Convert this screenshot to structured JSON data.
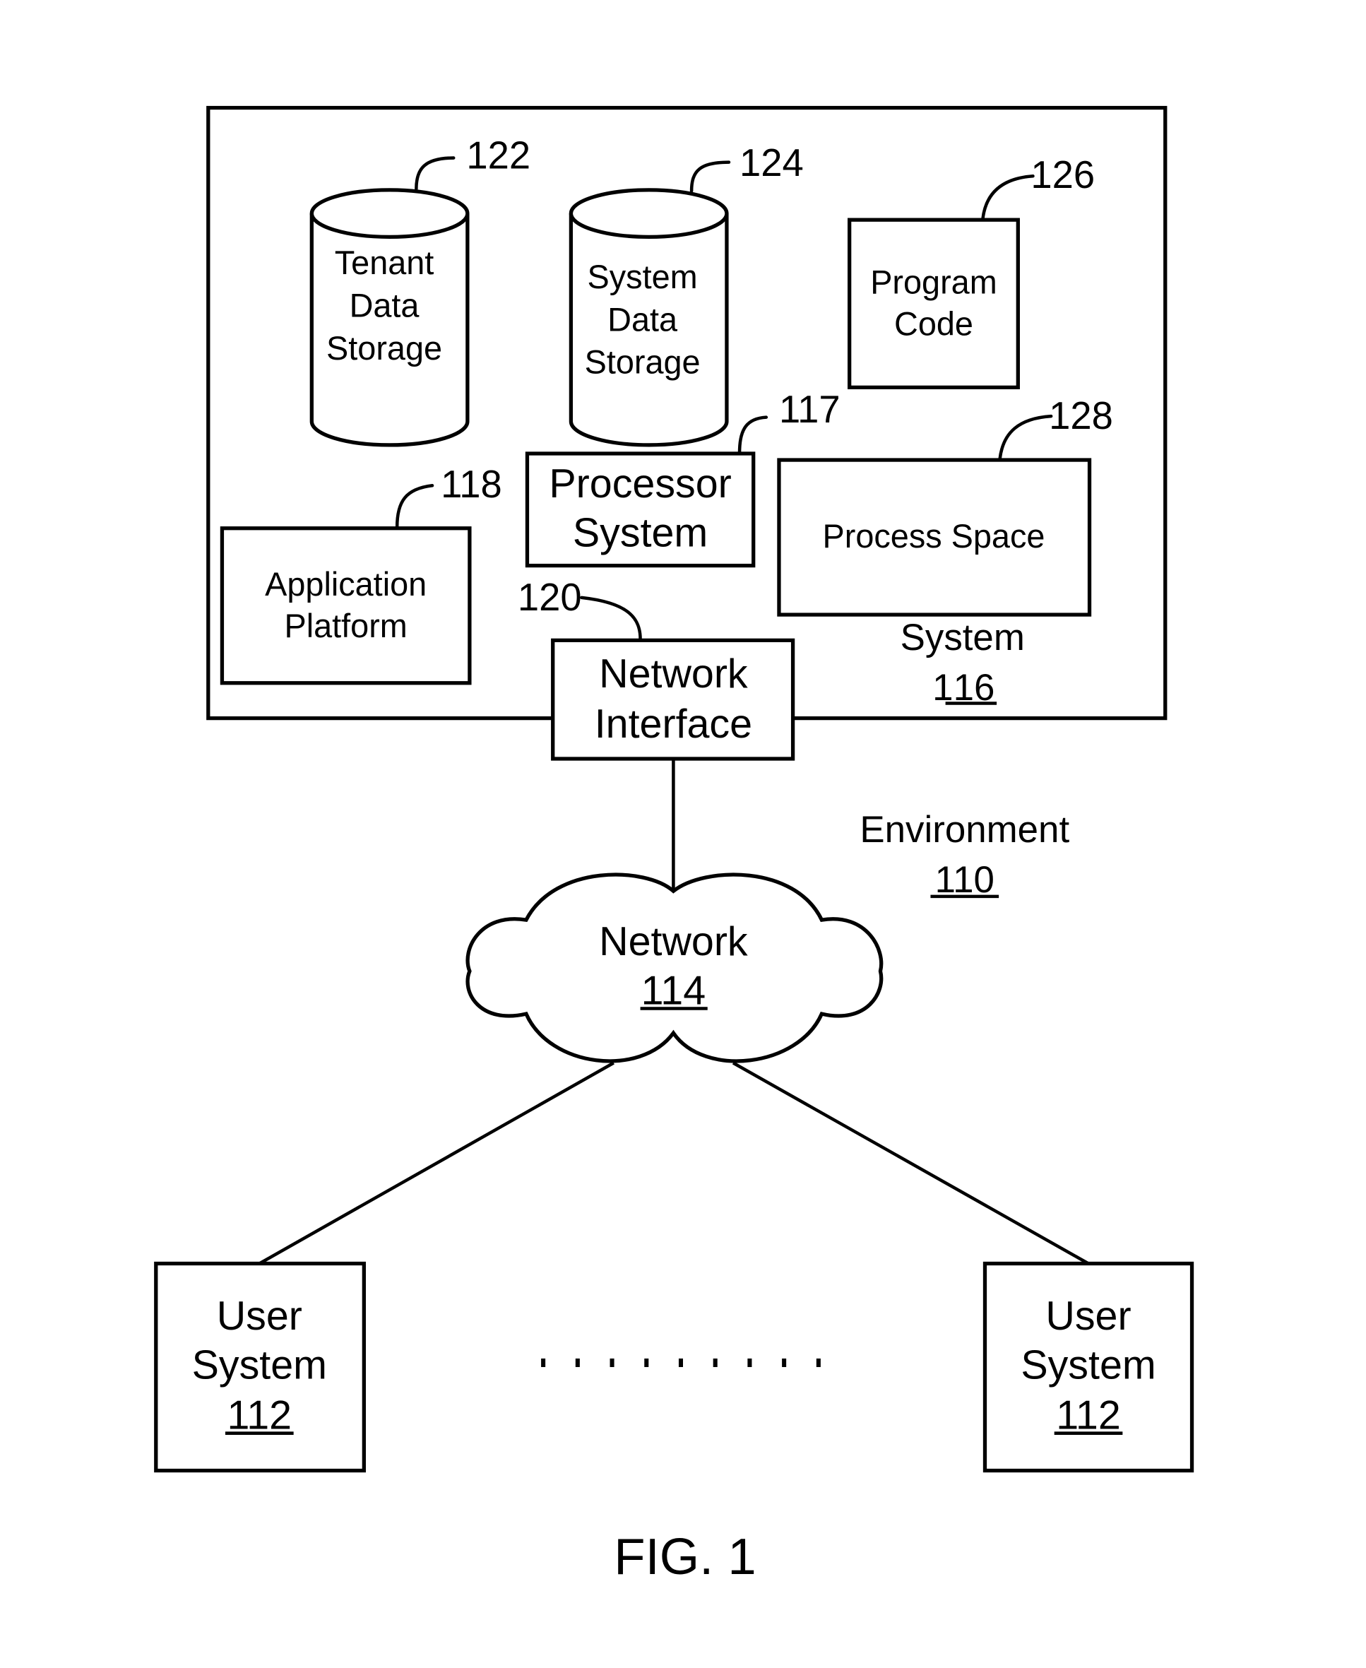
{
  "figure": {
    "caption": "FIG. 1",
    "colors": {
      "stroke": "#000000",
      "background": "#ffffff"
    }
  },
  "system": {
    "name": "System",
    "ref_prefix": "1",
    "ref_underlined": "16",
    "components": {
      "tenant_data_storage": {
        "lines": [
          "Tenant",
          "Data",
          "Storage"
        ],
        "ref": "122",
        "shape": "cylinder"
      },
      "system_data_storage": {
        "lines": [
          "System",
          "Data",
          "Storage"
        ],
        "ref": "124",
        "shape": "cylinder"
      },
      "program_code": {
        "lines": [
          "Program",
          "Code"
        ],
        "ref": "126",
        "shape": "box"
      },
      "processor_system": {
        "lines": [
          "Processor",
          "System"
        ],
        "ref": "117",
        "shape": "box"
      },
      "process_space": {
        "lines": [
          "Process Space"
        ],
        "ref": "128",
        "shape": "box"
      },
      "application_platform": {
        "lines": [
          "Application",
          "Platform"
        ],
        "ref": "118",
        "shape": "box"
      },
      "network_interface": {
        "lines": [
          "Network",
          "Interface"
        ],
        "ref": "120",
        "shape": "box"
      }
    }
  },
  "environment": {
    "name": "Environment",
    "ref": "110"
  },
  "network": {
    "name": "Network",
    "ref": "114",
    "shape": "cloud-icon"
  },
  "user_systems": [
    {
      "lines": [
        "User",
        "System"
      ],
      "ref": "112"
    },
    {
      "lines": [
        "User",
        "System"
      ],
      "ref": "112"
    }
  ],
  "ellipsis_dot_count": 9
}
